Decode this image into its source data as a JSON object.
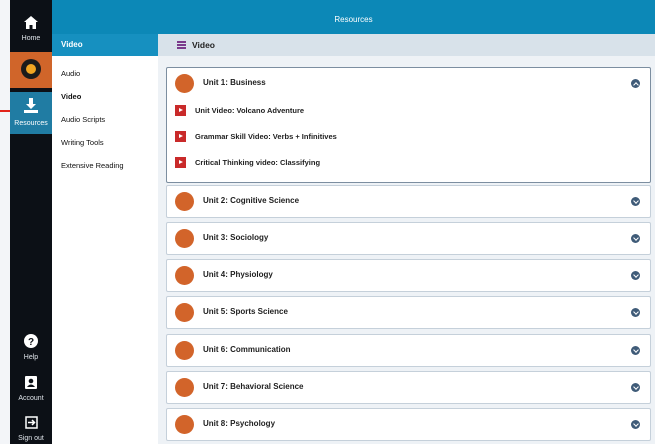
{
  "app": {
    "title": "Resources"
  },
  "rail": {
    "home": {
      "label": "Home",
      "icon": "home-icon"
    },
    "brand": {
      "icon": "q-logo-icon"
    },
    "resources": {
      "label": "Resources",
      "icon": "download-icon"
    },
    "help": {
      "label": "Help",
      "icon": "help-icon"
    },
    "account": {
      "label": "Account",
      "icon": "account-icon"
    },
    "signout": {
      "label": "Sign out",
      "icon": "sign-out-icon"
    }
  },
  "sidebar": {
    "header": "Video",
    "links": [
      {
        "label": "Audio",
        "active": false
      },
      {
        "label": "Video",
        "active": true
      },
      {
        "label": "Audio Scripts",
        "active": false
      },
      {
        "label": "Writing Tools",
        "active": false
      },
      {
        "label": "Extensive Reading",
        "active": false
      }
    ]
  },
  "main": {
    "header": "Video",
    "units": [
      {
        "title": "Unit 1: Business",
        "expanded": true,
        "resources": [
          "Unit Video: Volcano Adventure",
          "Grammar Skill Video: Verbs + Infinitives",
          "Critical Thinking video: Classifying"
        ]
      },
      {
        "title": "Unit 2: Cognitive Science",
        "expanded": false
      },
      {
        "title": "Unit 3: Sociology",
        "expanded": false
      },
      {
        "title": "Unit 4: Physiology",
        "expanded": false
      },
      {
        "title": "Unit 5: Sports Science",
        "expanded": false
      },
      {
        "title": "Unit 6: Communication",
        "expanded": false
      },
      {
        "title": "Unit 7: Behavioral Science",
        "expanded": false
      },
      {
        "title": "Unit 8: Psychology",
        "expanded": false
      }
    ]
  },
  "colors": {
    "accent_blue": "#0c88b7",
    "unit_orange": "#d2642a",
    "play_red": "#c92a2a",
    "rail_dark": "#0c1016"
  }
}
